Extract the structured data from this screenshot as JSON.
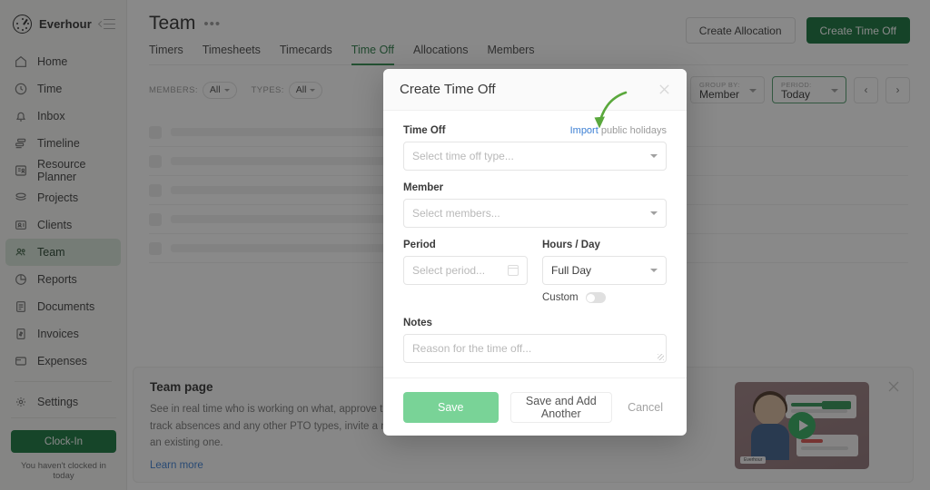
{
  "sidebar": {
    "brand": "Everhour",
    "collapse_icon": "collapse-icon",
    "items": [
      {
        "label": "Home",
        "icon": "home-icon"
      },
      {
        "label": "Time",
        "icon": "clock-icon"
      },
      {
        "label": "Inbox",
        "icon": "bell-icon"
      },
      {
        "label": "Timeline",
        "icon": "timeline-icon"
      },
      {
        "label": "Resource Planner",
        "icon": "resource-planner-icon"
      },
      {
        "label": "Projects",
        "icon": "projects-icon"
      },
      {
        "label": "Clients",
        "icon": "clients-icon"
      },
      {
        "label": "Team",
        "icon": "team-icon"
      },
      {
        "label": "Reports",
        "icon": "reports-icon"
      },
      {
        "label": "Documents",
        "icon": "documents-icon"
      },
      {
        "label": "Invoices",
        "icon": "invoices-icon"
      },
      {
        "label": "Expenses",
        "icon": "expenses-icon"
      }
    ],
    "settings": {
      "label": "Settings",
      "icon": "gear-icon"
    },
    "clock_in_button": "Clock-In",
    "clock_note": "You haven't clocked in today",
    "active_item": "Team"
  },
  "header": {
    "title": "Team",
    "more_icon": "ellipsis-icon",
    "tabs": [
      {
        "label": "Timers"
      },
      {
        "label": "Timesheets"
      },
      {
        "label": "Timecards"
      },
      {
        "label": "Time Off"
      },
      {
        "label": "Allocations"
      },
      {
        "label": "Members"
      }
    ],
    "active_tab": "Time Off",
    "create_allocation_button": "Create Allocation",
    "create_time_off_button": "Create Time Off"
  },
  "filters": {
    "members_label": "MEMBERS:",
    "members_value": "All",
    "types_label": "TYPES:",
    "types_value": "All",
    "group_by_caption": "GROUP BY:",
    "group_by_value": "Member",
    "period_caption": "PERIOD:",
    "period_value": "Today",
    "prev_icon": "chevron-left-icon",
    "next_icon": "chevron-right-icon"
  },
  "promo": {
    "title": "Team page",
    "text": "See in real time who is working on what, approve timesheets and timecards, track absences and any other PTO types, invite a new employee or deactivate an existing one.",
    "link": "Learn more",
    "play_icon": "play-icon",
    "close_icon": "close-icon"
  },
  "modal": {
    "title": "Create Time Off",
    "close_icon": "close-icon",
    "time_off_label": "Time Off",
    "import_link_text": "Import",
    "import_rest_text": " public holidays",
    "time_off_placeholder": "Select time off type...",
    "member_label": "Member",
    "member_placeholder": "Select members...",
    "period_label": "Period",
    "period_placeholder": "Select period...",
    "hours_day_label": "Hours / Day",
    "hours_day_value": "Full Day",
    "custom_label": "Custom",
    "custom_toggle_state": "off",
    "notes_label": "Notes",
    "notes_placeholder": "Reason for the time off...",
    "save_button": "Save",
    "save_add_another_button": "Save and Add Another",
    "cancel_button": "Cancel"
  },
  "annotation": {
    "arrow": "green-curved-arrow",
    "color": "#5aa83c"
  },
  "colors": {
    "brand_green": "#14713a",
    "accent_green": "#2f8b4f",
    "save_green": "#79d397",
    "link_blue": "#3b7fd4",
    "overlay": "#181818"
  }
}
